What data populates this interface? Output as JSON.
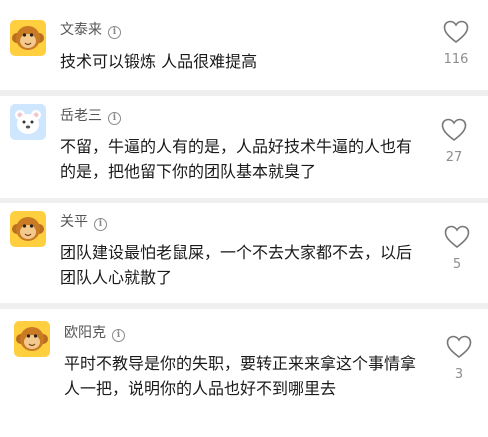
{
  "comments": [
    {
      "author": "文泰来",
      "avatar": "monkey-avatar",
      "text": "技术可以锻炼 人品很难提高",
      "likes": "116"
    },
    {
      "author": "岳老三",
      "avatar": "bear-avatar",
      "text": "不留，牛逼的人有的是，人品好技术牛逼的人也有的是，把他留下你的团队基本就臭了",
      "likes": "27"
    },
    {
      "author": "关平",
      "avatar": "monkey-avatar",
      "text": "团队建设最怕老鼠屎，一个不去大家都不去，以后团队人心就散了",
      "likes": "5"
    },
    {
      "author": "欧阳克",
      "avatar": "monkey-avatar",
      "text": "平时不教导是你的失职，要转正来来拿这个事情拿人一把，说明你的人品也好不到哪里去",
      "likes": "3"
    }
  ],
  "colors": {
    "avatar_bg_monkey": "#ffcf40",
    "avatar_bg_bear": "#cfe6ff",
    "heart_stroke": "#777777",
    "divider": "#efefef"
  }
}
